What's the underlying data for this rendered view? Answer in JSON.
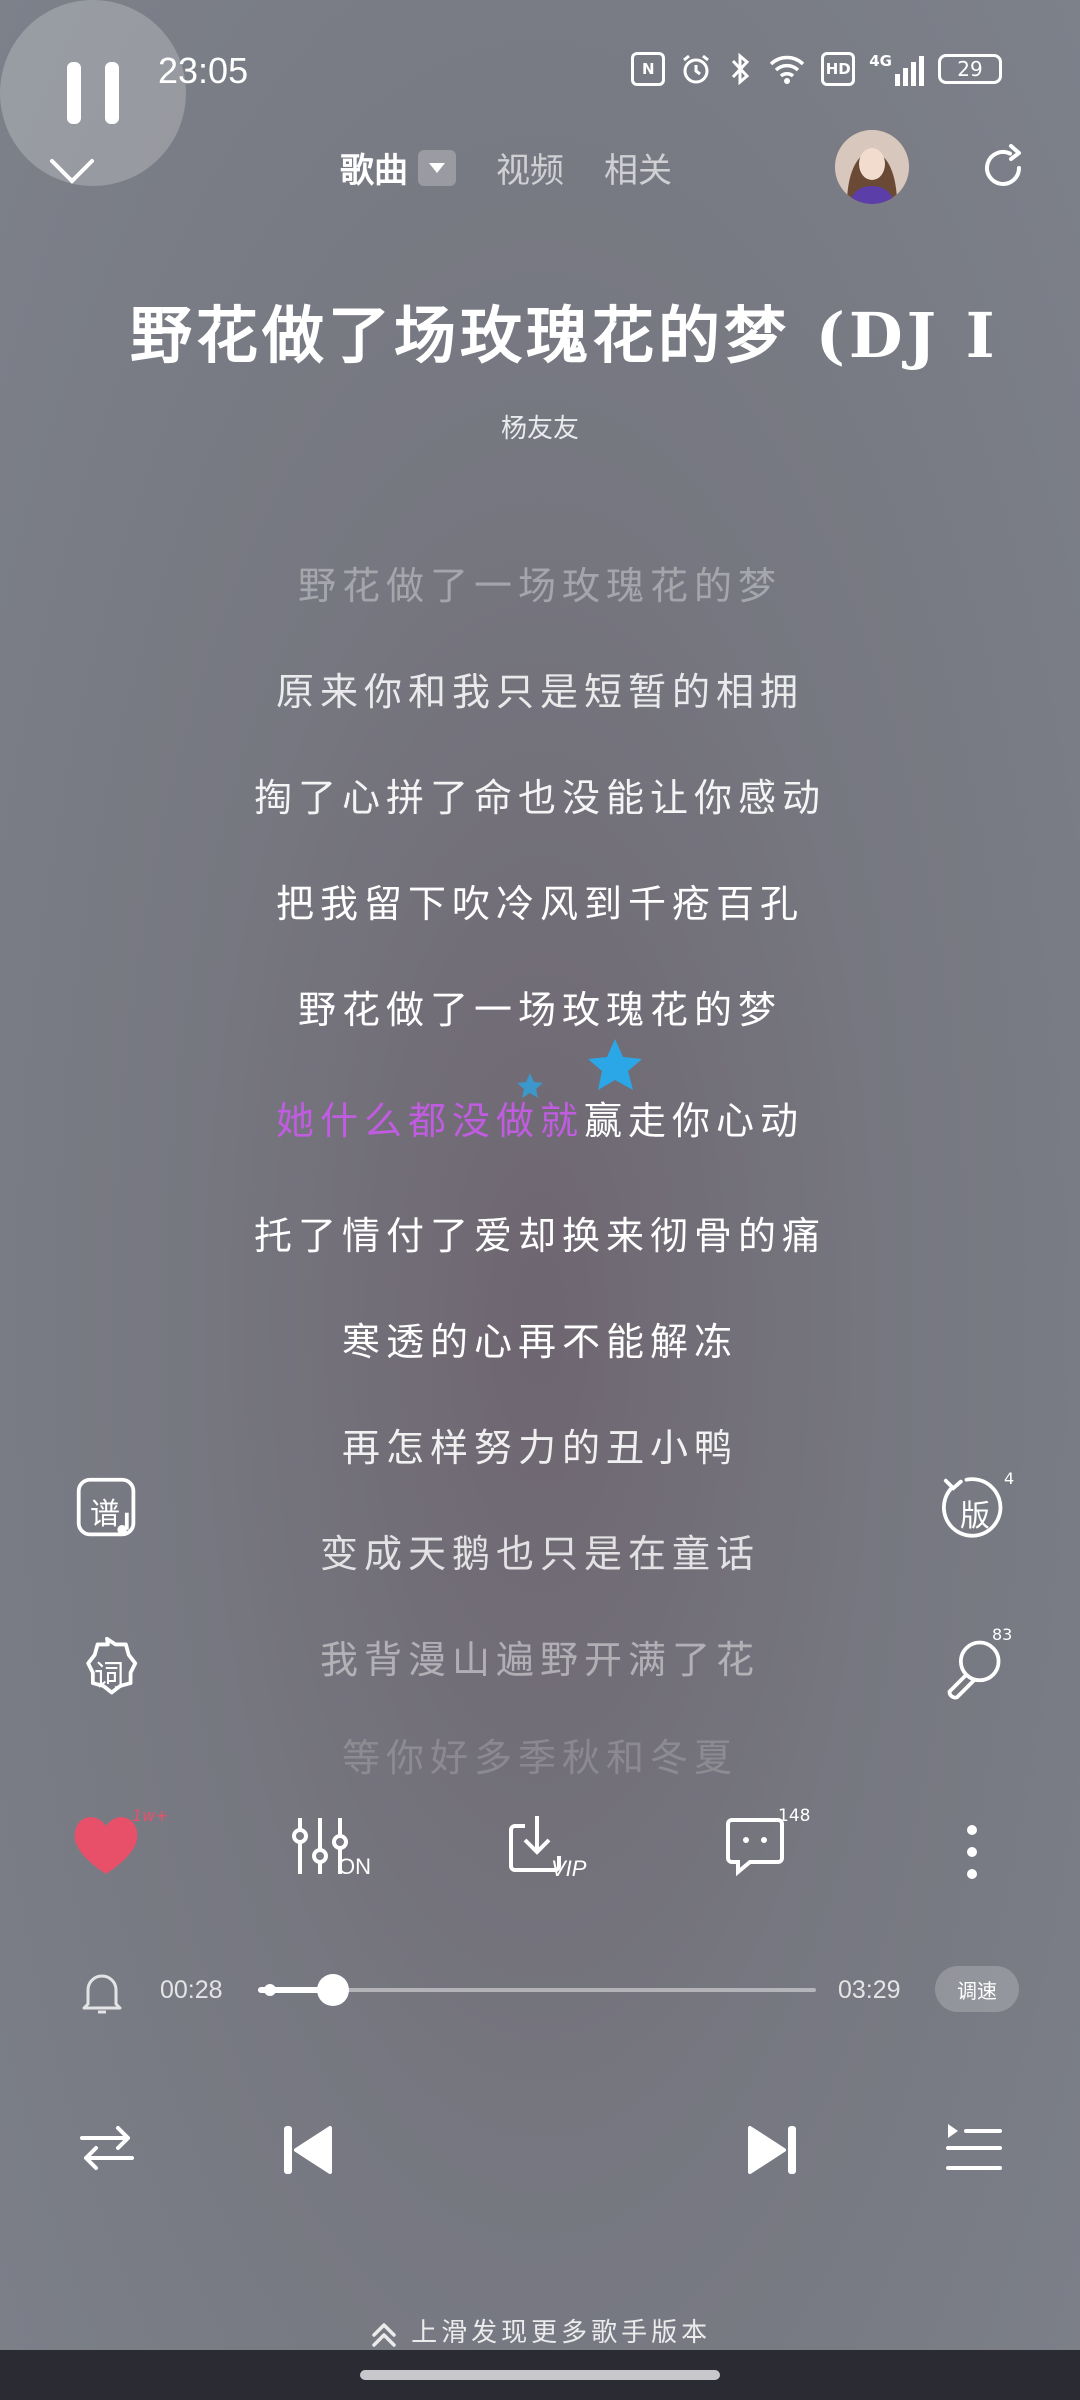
{
  "status_bar": {
    "time": "23:05",
    "icons": [
      "nfc-icon",
      "alarm-icon",
      "bluetooth-icon",
      "wifi-icon",
      "hd-icon",
      "signal-4g-icon"
    ],
    "hd_label": "HD",
    "net_label": "4G",
    "battery": "29"
  },
  "header": {
    "tabs": [
      {
        "label": "歌曲",
        "active": true
      },
      {
        "label": "视频",
        "active": false
      },
      {
        "label": "相关",
        "active": false
      }
    ]
  },
  "song": {
    "title": "野花做了场玫瑰花的梦 (DJ I",
    "artist": "杨友友"
  },
  "lyrics": {
    "lines": [
      "野花做了一场玫瑰花的梦",
      "原来你和我只是短暂的相拥",
      "掏了心拼了命也没能让你感动",
      "把我留下吹冷风到千疮百孔",
      "野花做了一场玫瑰花的梦",
      "她什么都没做就赢走你心动",
      "托了情付了爱却换来彻骨的痛",
      "寒透的心再不能解冻",
      "再怎样努力的丑小鸭",
      "变成天鹅也只是在童话",
      "我背漫山遍野开满了花",
      "等你好多季秋和冬夏"
    ],
    "current_sung": "她什么都没做就",
    "current_rest": "赢走你心动"
  },
  "side_buttons": {
    "score_label": "谱",
    "lyrics_label": "词",
    "version_label": "版",
    "version_count": "4",
    "effect_count": "83"
  },
  "actions": {
    "like_count": "1w+",
    "eq_label": "ON",
    "download_label": "VIP",
    "comment_count": "148"
  },
  "progress": {
    "elapsed": "00:28",
    "total": "03:29",
    "fraction": 0.134,
    "speed_label": "调速"
  },
  "controls": {
    "state": "playing"
  },
  "footer": {
    "hint": "上滑发现更多歌手版本"
  },
  "colors": {
    "accent_lyric": "#c05ce0",
    "like": "#e8506a"
  }
}
